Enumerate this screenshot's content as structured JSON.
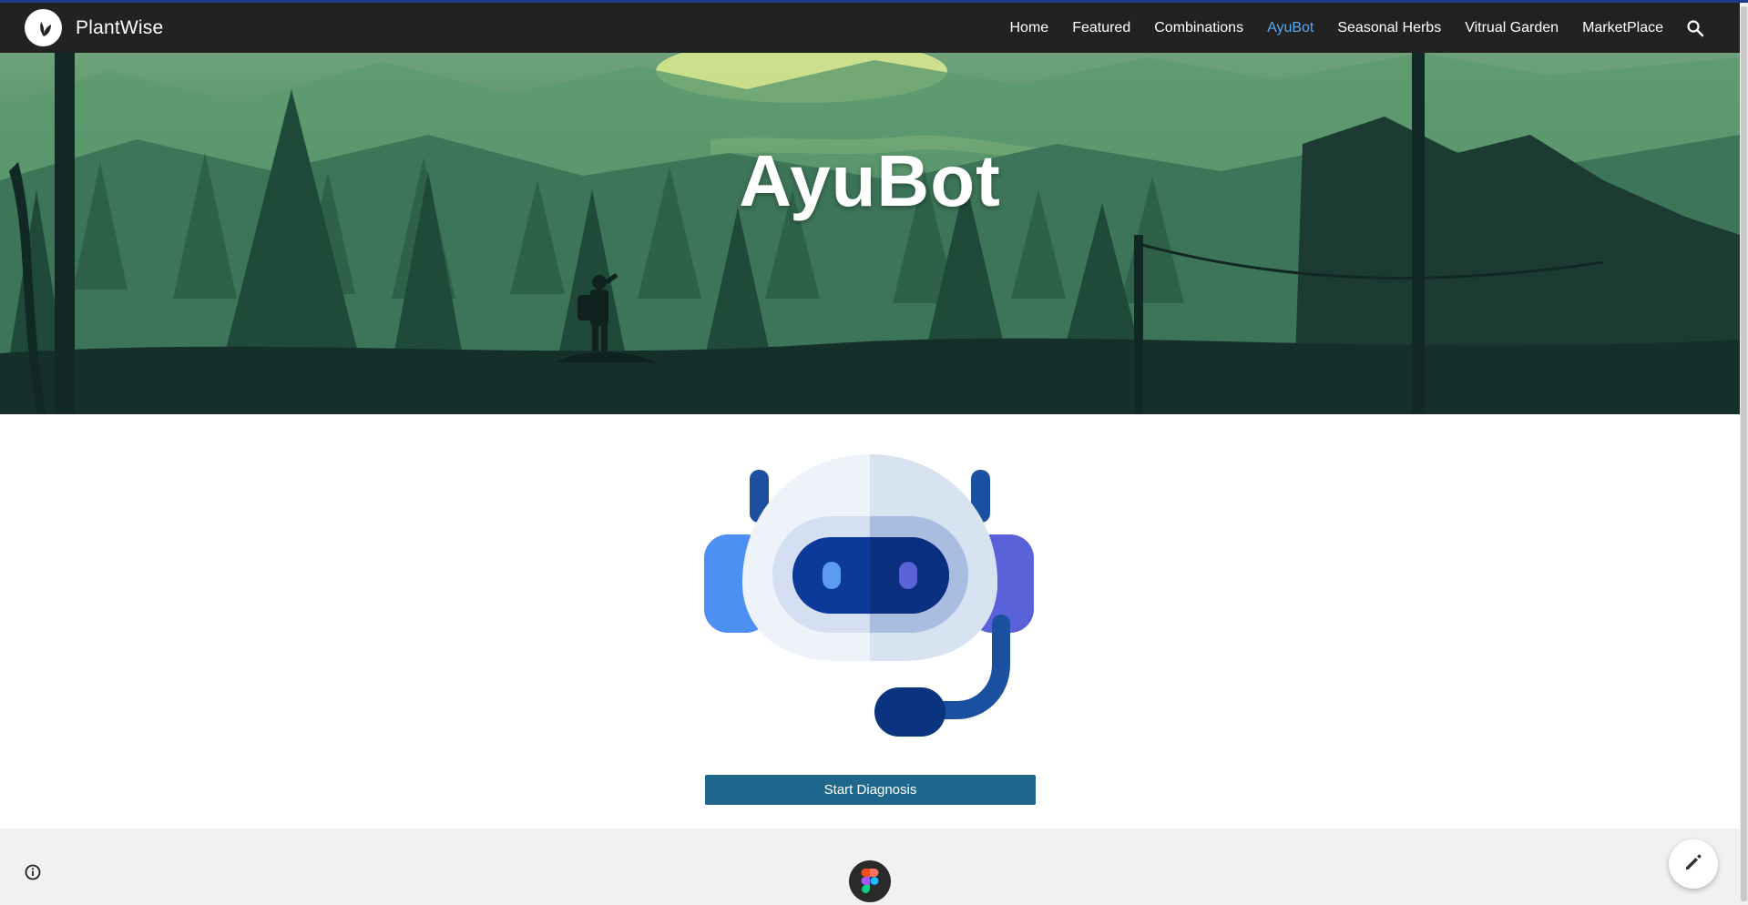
{
  "site": {
    "brand": "PlantWise",
    "logo_icon": "leaf-icon"
  },
  "nav": {
    "items": [
      {
        "label": "Home"
      },
      {
        "label": "Featured"
      },
      {
        "label": "Combinations"
      },
      {
        "label": "AyuBot"
      },
      {
        "label": "Seasonal Herbs"
      },
      {
        "label": "Vitrual Garden"
      },
      {
        "label": "MarketPlace"
      }
    ],
    "active": "AyuBot",
    "search_icon": "search-icon"
  },
  "hero": {
    "title": "AyuBot"
  },
  "main": {
    "robot_icon": "robot-headset-icon",
    "cta_label": "Start Diagnosis"
  },
  "footer": {
    "info_icon": "info-icon",
    "figma_icon": "figma-icon",
    "edit_icon": "pencil-icon"
  },
  "colors": {
    "navbar": "#222222",
    "active_link": "#5aa8f0",
    "cta": "#20678e",
    "footer": "#f1f1f1"
  }
}
